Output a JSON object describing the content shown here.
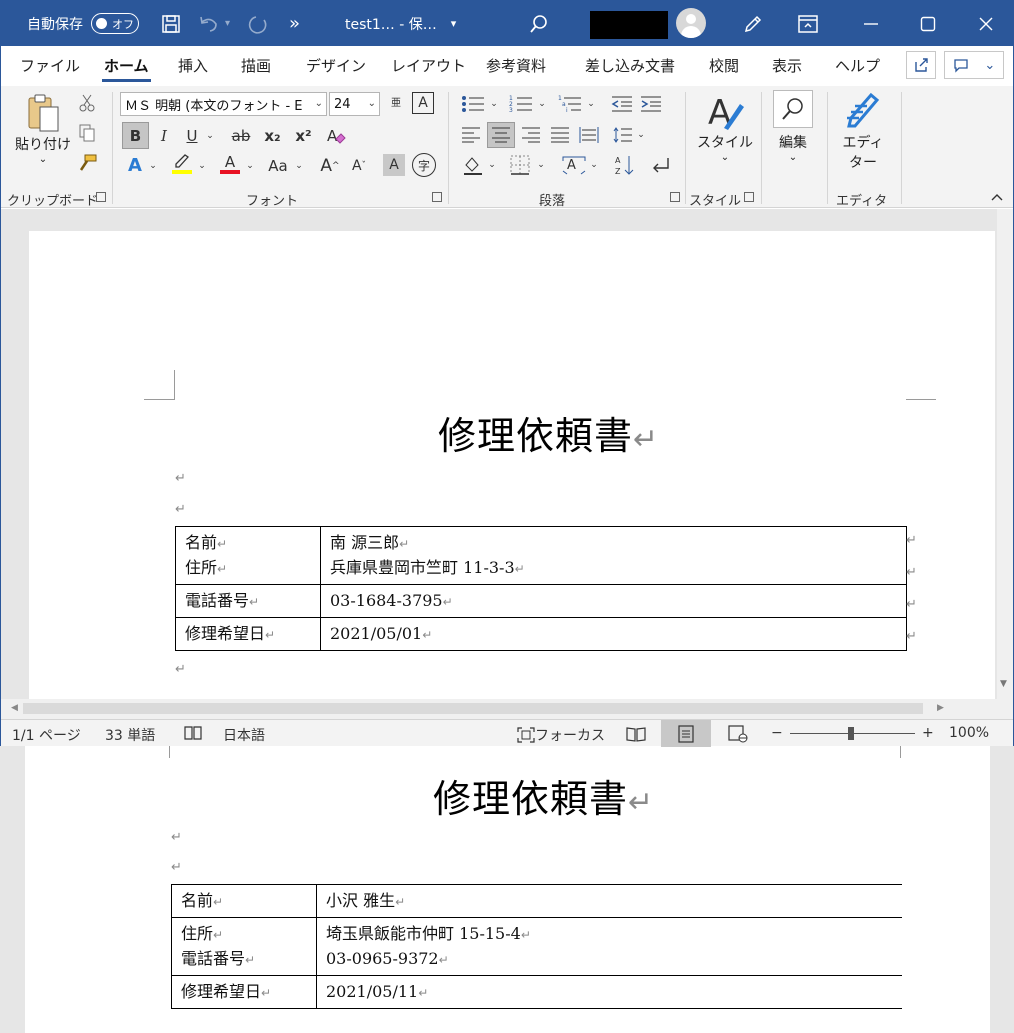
{
  "titlebar": {
    "autosave_label": "自動保存",
    "autosave_state": "オフ",
    "more_glyph": "»",
    "filename": "test1… - 保…",
    "filename_dropdown": "▾"
  },
  "tabs": [
    "ファイル",
    "ホーム",
    "挿入",
    "描画",
    "デザイン",
    "レイアウト",
    "参考資料",
    "差し込み文書",
    "校閲",
    "表示",
    "ヘルプ"
  ],
  "active_tab": "ホーム",
  "ribbon": {
    "clipboard": {
      "paste_label": "貼り付け",
      "group_label": "クリップボード"
    },
    "font": {
      "font_name": "ＭＳ 明朝 (本文のフォント - E",
      "font_size": "24",
      "bold": "B",
      "italic": "I",
      "underline": "U",
      "strike": "ab",
      "subscript": "x₂",
      "superscript": "x²",
      "text_effects": "A",
      "highlight": "A",
      "font_color": "A",
      "change_case": "Aa",
      "grow": "A",
      "shrink": "A",
      "char_shading": "A",
      "enclose": "字",
      "ruby": "亜",
      "border_char": "A",
      "group_label": "フォント"
    },
    "paragraph": {
      "group_label": "段落"
    },
    "styles": {
      "label": "スタイル",
      "group_label": "スタイル"
    },
    "editing": {
      "label": "編集"
    },
    "editor": {
      "label_line1": "エディ",
      "label_line2": "ター",
      "group_label": "エディタ"
    }
  },
  "document": {
    "title": "修理依頼書",
    "para_mark": "↵",
    "rows": [
      {
        "label_lines": [
          "名前",
          "住所"
        ],
        "value_lines": [
          "南 源三郎",
          "兵庫県豊岡市竺町 11-3-3"
        ]
      },
      {
        "label_lines": [
          "電話番号"
        ],
        "value_lines": [
          "03-1684-3795"
        ]
      },
      {
        "label_lines": [
          "修理希望日"
        ],
        "value_lines": [
          "2021/05/01"
        ]
      }
    ]
  },
  "background_document": {
    "title": "修理依頼書",
    "rows": [
      {
        "label_lines": [
          "名前"
        ],
        "value_lines": [
          "小沢 雅生"
        ]
      },
      {
        "label_lines": [
          "住所",
          "電話番号"
        ],
        "value_lines": [
          "埼玉県飯能市仲町 15-15-4",
          "03-0965-9372"
        ]
      },
      {
        "label_lines": [
          "修理希望日"
        ],
        "value_lines": [
          "2021/05/11"
        ]
      }
    ]
  },
  "statusbar": {
    "page": "1/1 ページ",
    "words": "33 単語",
    "language": "日本語",
    "focus": "フォーカス",
    "zoom_minus": "−",
    "zoom_plus": "+",
    "zoom": "100%"
  },
  "colors": {
    "title_bar": "#2b579a",
    "highlight_bar": "#ffff00",
    "font_color_bar": "#e81123"
  }
}
